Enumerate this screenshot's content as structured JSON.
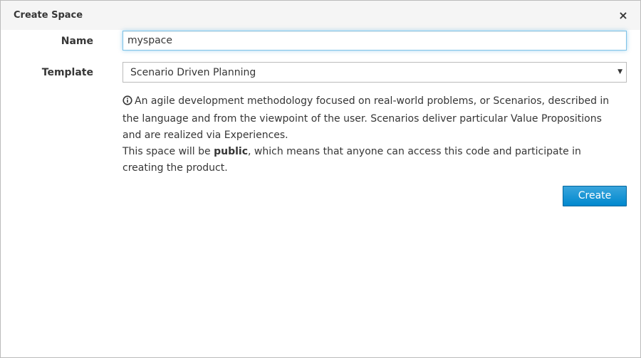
{
  "dialog": {
    "title": "Create Space",
    "close_glyph": "×"
  },
  "form": {
    "name_label": "Name",
    "name_value": "myspace",
    "template_label": "Template",
    "template_selected": "Scenario Driven Planning"
  },
  "description": {
    "icon": "info-circle-icon",
    "text_line1": "An agile development methodology focused on real-world problems, or Scenarios, described in the language and from the viewpoint of the user. Scenarios deliver particular Value Propositions and are realized via Experiences.",
    "visibility_prefix": "This space will be ",
    "visibility_word": "public",
    "visibility_suffix": ", which means that anyone can access this code and participate in creating the product."
  },
  "actions": {
    "create_label": "Create"
  },
  "colors": {
    "primary": "#0088ce",
    "header_bg": "#f5f5f5",
    "text": "#363636"
  }
}
